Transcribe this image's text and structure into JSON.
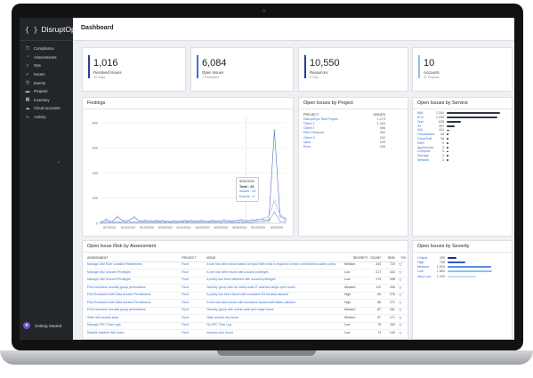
{
  "app": {
    "name": "DisruptOps",
    "page_title": "Dashboard"
  },
  "sidebar": {
    "items": [
      {
        "label": "Compliance",
        "icon": "shield-icon"
      },
      {
        "label": "Assessments",
        "icon": "gauge-icon"
      },
      {
        "label": "Ops",
        "icon": "ops-icon"
      },
      {
        "label": "Issues",
        "icon": "check-icon"
      },
      {
        "label": "Events",
        "icon": "events-icon"
      },
      {
        "label": "Projects",
        "icon": "folder-icon"
      },
      {
        "label": "Inventory",
        "icon": "grid-icon"
      },
      {
        "label": "Cloud accounts",
        "icon": "cloud-icon"
      },
      {
        "label": "Activity",
        "icon": "activity-icon"
      }
    ],
    "getting_started": "Getting Started"
  },
  "stats": [
    {
      "value": "1,016",
      "label": "Resolved Issues",
      "sub": "30 Days",
      "color": "#243f9c"
    },
    {
      "value": "6,084",
      "label": "Open Issues",
      "sub": "7 Exempted",
      "color": "#3b6fd8"
    },
    {
      "value": "10,550",
      "label": "Resources",
      "sub": "0 Ops",
      "color": "#243f9c"
    },
    {
      "value": "10",
      "label": "Accounts",
      "sub": "11 Projects",
      "color": "#8fc0ec"
    }
  ],
  "findings": {
    "title": "Findings",
    "tooltip": {
      "date": "5/26/2020",
      "total": "Total : 24",
      "issues": "Issues : 24",
      "events": "Events : 0"
    }
  },
  "chart_data": {
    "type": "line",
    "title": "Findings",
    "x_tick_labels": [
      "5/7/2020",
      "5/10/2020",
      "5/13/2020",
      "5/16/2020",
      "5/19/2020",
      "5/22/2020",
      "5/25/2020",
      "5/28/2020",
      "5/31/2020",
      "6/3/2020"
    ],
    "y_ticks": [
      0,
      200,
      400,
      600,
      800
    ],
    "ylim": [
      0,
      850
    ],
    "x": [
      1,
      2,
      3,
      4,
      5,
      6,
      7,
      8,
      9,
      10,
      11,
      12,
      13,
      14,
      15,
      16,
      17,
      18,
      19,
      20,
      21,
      22,
      23,
      24,
      25,
      26,
      27,
      28,
      29,
      30,
      31,
      32,
      33,
      34
    ],
    "series": [
      {
        "color": "#4f6fc4",
        "values": [
          8,
          30,
          10,
          52,
          18,
          22,
          48,
          14,
          22,
          16,
          20,
          18,
          12,
          16,
          14,
          20,
          18,
          16,
          22,
          12,
          20,
          16,
          24,
          18,
          20,
          26,
          18,
          24,
          28,
          30,
          20,
          740,
          55,
          30
        ]
      },
      {
        "color": "#95b5e8",
        "values": [
          4,
          10,
          8,
          12,
          10,
          8,
          12,
          10,
          10,
          8,
          10,
          9,
          8,
          10,
          9,
          10,
          10,
          9,
          10,
          8,
          12,
          10,
          10,
          11,
          10,
          12,
          11,
          12,
          24,
          40,
          55,
          180,
          70,
          40
        ]
      },
      {
        "color": "#7f93c9",
        "values": [
          2,
          4,
          4,
          6,
          4,
          4,
          6,
          4,
          4,
          4,
          4,
          4,
          4,
          4,
          4,
          4,
          4,
          4,
          4,
          4,
          4,
          4,
          4,
          4,
          4,
          4,
          4,
          4,
          10,
          12,
          16,
          90,
          14,
          10
        ]
      }
    ]
  },
  "issues_by_project": {
    "title": "Open Issues by Project",
    "headers": [
      "PROJECT",
      "ISSUES"
    ],
    "rows": [
      [
        "DisruptOps Test Project",
        "1,173"
      ],
      [
        "Client 2",
        "1,164"
      ],
      [
        "Client 1",
        "498"
      ],
      [
        "Rich Personal",
        "262"
      ],
      [
        "Client 3",
        "232"
      ],
      [
        "Vault",
        "199"
      ],
      [
        "Root",
        "165"
      ]
    ]
  },
  "issues_by_service": {
    "title": "Open Issues by Service",
    "rows": [
      {
        "name": "IAM",
        "value": "2,340",
        "n": 2340
      },
      {
        "name": "EC2",
        "value": "2,236",
        "n": 2236
      },
      {
        "name": "Test",
        "value": "628",
        "n": 628
      },
      {
        "name": "S3",
        "value": "357",
        "n": 357
      },
      {
        "name": "N/A",
        "value": "124",
        "n": 124
      },
      {
        "name": "CloudWatch",
        "value": "46",
        "n": 46
      },
      {
        "name": "CloudTrail",
        "value": "38",
        "n": 38
      },
      {
        "name": "KMS",
        "value": "9",
        "n": 9
      },
      {
        "name": "AppService",
        "value": "5",
        "n": 5
      },
      {
        "name": "Compute",
        "value": "3",
        "n": 3
      },
      {
        "name": "Storage",
        "value": "3",
        "n": 3
      },
      {
        "name": "Network",
        "value": "3",
        "n": 3
      }
    ]
  },
  "risk": {
    "title": "Open Issue Risk by Assessment",
    "headers": [
      "ASSESSMENT",
      "PROJECT",
      "ISSUE",
      "SEVERITY",
      "COUNT",
      "RISK",
      "FIX"
    ],
    "rows": [
      [
        "Manage IAM Role Location Restrictions",
        "Root",
        "A role has been found based on input filters that is required to have a restricted location policy",
        "Medium",
        "240",
        "720"
      ],
      [
        "Manage IAM Unused Privileges",
        "Root",
        "A role has been found with unused privileges",
        "Low",
        "217",
        "434"
      ],
      [
        "Manage IAM Unused Privileges",
        "Root",
        "A policy has been detected with unused privileges",
        "Low",
        "174",
        "348"
      ],
      [
        "Find excessive security group permissions",
        "Root",
        "Security group with an overly-wide IP address range open found",
        "Medium",
        "112",
        "336"
      ],
      [
        "Find Excessive IAM Data Access Permissions",
        "Root",
        "A policy has been found with excessive S3 buckets allowed",
        "High",
        "69",
        "276"
      ],
      [
        "Find Excessive IAM Data Access Permissions",
        "Root",
        "A role has been found with excessive DynamoDB tables allowed",
        "High",
        "68",
        "272"
      ],
      [
        "Find excessive security group permissions",
        "Root",
        "Security group with overly-wide port range found",
        "Medium",
        "87",
        "261"
      ],
      [
        "Stale IAM access keys",
        "Root",
        "Stale access key found",
        "Medium",
        "57",
        "171"
      ],
      [
        "Manage VPC Flow Logs",
        "Root",
        "No VPC Flow Log",
        "Low",
        "75",
        "150"
      ],
      [
        "Disable Inactive IAM users",
        "Root",
        "Inactive user found",
        "Low",
        "73",
        "146"
      ]
    ]
  },
  "severity": {
    "title": "Open Issues by Severity",
    "rows": [
      {
        "name": "Critical",
        "value": "395",
        "n": 395,
        "color": "#1c2f73"
      },
      {
        "name": "High",
        "value": "756",
        "n": 756,
        "color": "#3858c8"
      },
      {
        "name": "Medium",
        "value": "1,835",
        "n": 1835,
        "color": "#5c8ee0"
      },
      {
        "name": "Low",
        "value": "1,889",
        "n": 1889,
        "color": "#8cc3ea"
      },
      {
        "name": "Very Low",
        "value": "1,209",
        "n": 1209,
        "color": "#c2e0f6"
      }
    ]
  }
}
